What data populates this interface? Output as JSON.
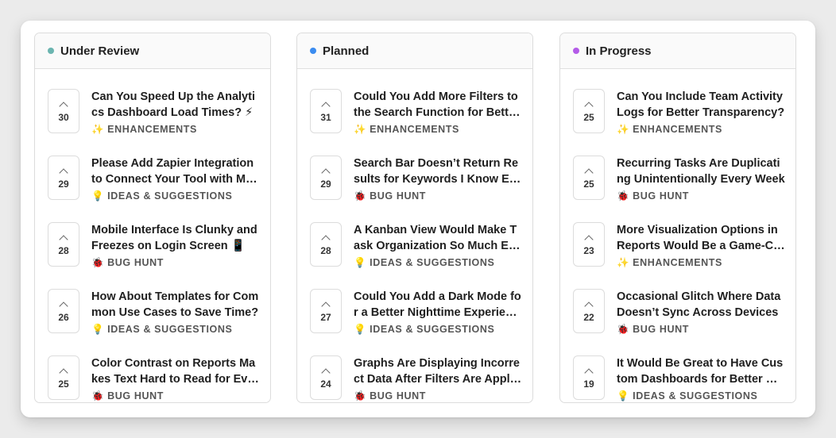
{
  "columns": [
    {
      "title": "Under Review",
      "color": "#6bb5b0",
      "posts": [
        {
          "votes": "30",
          "title": "Can You Speed Up the Analytics Dashboard Load Times? ⚡",
          "tag_emoji": "✨",
          "tag": "ENHANCEMENTS"
        },
        {
          "votes": "29",
          "title": "Please Add Zapier Integration to Connect Your Tool with My Apps",
          "tag_emoji": "💡",
          "tag": "IDEAS & SUGGESTIONS"
        },
        {
          "votes": "28",
          "title": "Mobile Interface Is Clunky and Freezes on Login Screen 📱",
          "tag_emoji": "🐞",
          "tag": "BUG HUNT"
        },
        {
          "votes": "26",
          "title": "How About Templates for Common Use Cases to Save Time?",
          "tag_emoji": "💡",
          "tag": "IDEAS & SUGGESTIONS"
        },
        {
          "votes": "25",
          "title": "Color Contrast on Reports Makes Text Hard to Read for Everyone",
          "tag_emoji": "🐞",
          "tag": "BUG HUNT"
        }
      ]
    },
    {
      "title": "Planned",
      "color": "#3b8cf0",
      "posts": [
        {
          "votes": "31",
          "title": "Could You Add More Filters to the Search Function for Better Results?",
          "tag_emoji": "✨",
          "tag": "ENHANCEMENTS"
        },
        {
          "votes": "29",
          "title": "Search Bar Doesn’t Return Results for Keywords I Know Exist",
          "tag_emoji": "🐞",
          "tag": "BUG HUNT"
        },
        {
          "votes": "28",
          "title": "A Kanban View Would Make Task Organization So Much Easier",
          "tag_emoji": "💡",
          "tag": "IDEAS & SUGGESTIONS"
        },
        {
          "votes": "27",
          "title": "Could You Add a Dark Mode for a Better Nighttime Experience?",
          "tag_emoji": "💡",
          "tag": "IDEAS & SUGGESTIONS"
        },
        {
          "votes": "24",
          "title": "Graphs Are Displaying Incorrect Data After Filters Are Applied",
          "tag_emoji": "🐞",
          "tag": "BUG HUNT"
        }
      ]
    },
    {
      "title": "In Progress",
      "color": "#b45ce8",
      "posts": [
        {
          "votes": "25",
          "title": "Can You Include Team Activity Logs for Better Transparency?",
          "tag_emoji": "✨",
          "tag": "ENHANCEMENTS"
        },
        {
          "votes": "25",
          "title": "Recurring Tasks Are Duplicating Unintentionally Every Week",
          "tag_emoji": "🐞",
          "tag": "BUG HUNT"
        },
        {
          "votes": "23",
          "title": "More Visualization Options in Reports Would Be a Game-Changer",
          "tag_emoji": "✨",
          "tag": "ENHANCEMENTS"
        },
        {
          "votes": "22",
          "title": "Occasional Glitch Where Data Doesn’t Sync Across Devices",
          "tag_emoji": "🐞",
          "tag": "BUG HUNT"
        },
        {
          "votes": "19",
          "title": "It Would Be Great to Have Custom Dashboards for Better Workflow",
          "tag_emoji": "💡",
          "tag": "IDEAS & SUGGESTIONS"
        }
      ]
    }
  ]
}
